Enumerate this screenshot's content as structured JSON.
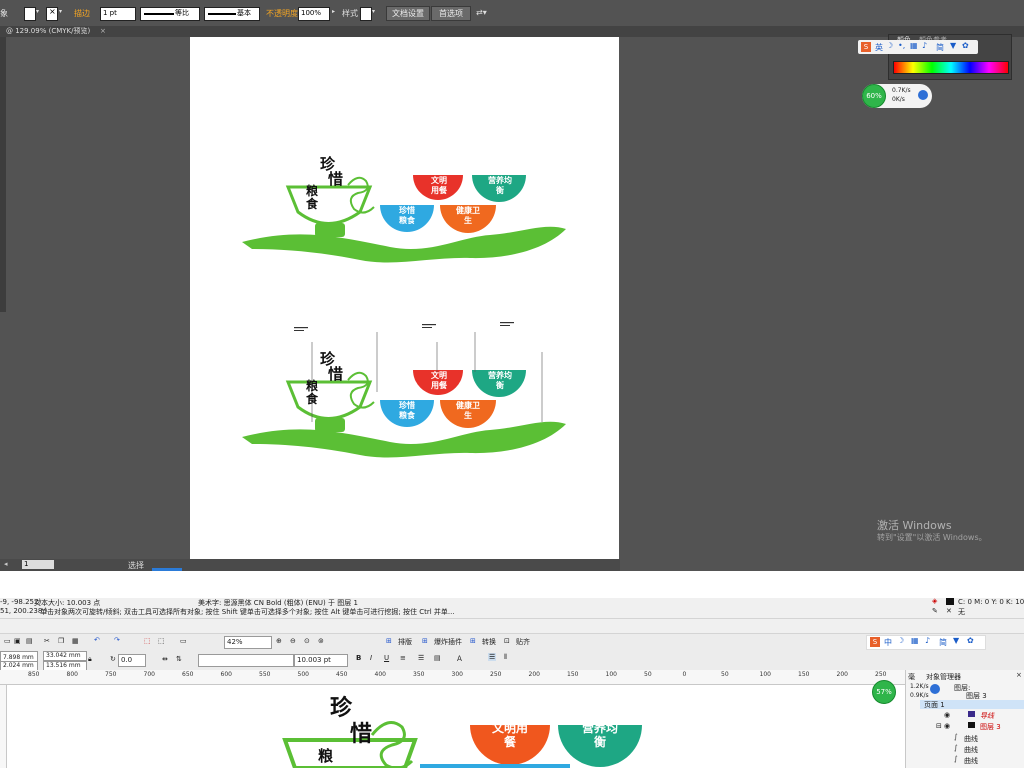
{
  "illustrator": {
    "toolbar": {
      "label_left": "象",
      "stroke_label": "描边",
      "stroke_width": "1 pt",
      "profile_equal": "等比",
      "brush_basic": "基本",
      "opacity_label": "不透明度",
      "opacity_value": "100%",
      "style_label": "样式",
      "doc_setup_btn": "文档设置",
      "preferences_btn": "首选项"
    },
    "doc_tab": "@ 129.09% (CMYK/预览)",
    "status": {
      "zoom_value": "1",
      "selection_label": "选择"
    },
    "color_panel": {
      "tab1": "颜色",
      "tab2": "颜色参考"
    },
    "ime": {
      "lang": "英",
      "simplified": "简"
    },
    "net_widget": {
      "percent": "60%",
      "up": "0.7K/s",
      "down": "0K/s"
    },
    "windows_activation": {
      "line1": "激活 Windows",
      "line2": "转到\"设置\"以激活 Windows。"
    }
  },
  "artwork": {
    "title_chars": [
      "珍",
      "惜",
      "粮",
      "食"
    ],
    "bowls": [
      {
        "text": "文明用餐",
        "color": "#e8322a"
      },
      {
        "text": "营养均衡",
        "color": "#1ea784"
      },
      {
        "text": "珍惜粮食",
        "color": "#2fa9e1"
      },
      {
        "text": "健康卫生",
        "color": "#f0691f"
      }
    ],
    "wave_color": "#5bbf35"
  },
  "coreldraw": {
    "info": {
      "coords1": "-9, -98.252)",
      "text_size": "文本大小: 10.003 点",
      "art_text": "美术字: 思源黑体 CN Bold (粗体) (ENU) 于 图层 1",
      "coords2": "51, 200.238 )",
      "hint": "单击对象两次可旋转/倾斜; 双击工具可选择所有对象; 按住 Shift 键单击可选择多个对象; 按住 Alt 键单击可进行挖掘; 按住 Ctrl 并单...",
      "fill_info": "C: 0 M: 0 Y: 0 K: 100",
      "outline_info": "无"
    },
    "toolbar": {
      "zoom": "42%",
      "menu1": "排版",
      "menu2": "爆炸插件",
      "menu3": "转换",
      "menu4": "贴齐"
    },
    "props": {
      "x": "7.898 mm",
      "y": "2.024 mm",
      "w": "33.042 mm",
      "h": "13.516 mm",
      "angle": "0.0",
      "font_size": "10.003 pt"
    },
    "ruler_ticks": [
      "850",
      "800",
      "750",
      "700",
      "650",
      "600",
      "550",
      "500",
      "450",
      "400",
      "350",
      "300",
      "250",
      "200",
      "150",
      "100",
      "50",
      "0",
      "50",
      "100",
      "150",
      "200",
      "250"
    ],
    "canvas_bowls": [
      {
        "text": "文明用餐",
        "color": "#f0571e"
      },
      {
        "text": "营养均衡",
        "color": "#1ea784"
      }
    ],
    "object_manager": {
      "tab1": "对象管理器",
      "tab2": "毫",
      "percent": "57%",
      "up": "1.2K/s",
      "down": "0.9K/s",
      "layer_label": "图层:",
      "layer_value": "图层 3",
      "page": "页面 1",
      "guides": "导线",
      "layer3": "图层 3",
      "items": [
        "曲线",
        "曲线",
        "曲线"
      ]
    }
  }
}
